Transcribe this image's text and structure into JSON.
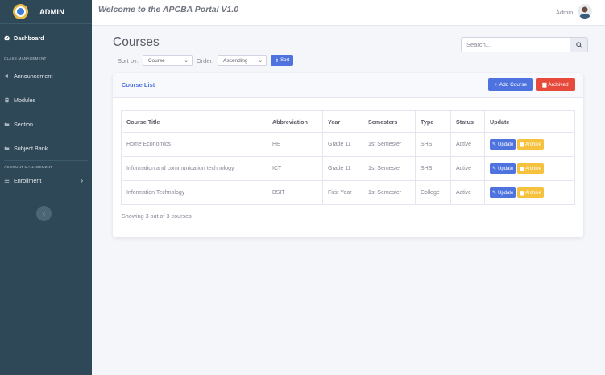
{
  "sidebar": {
    "brand": "ADMIN",
    "items": [
      {
        "label": "Dashboard"
      },
      {
        "heading": "CLASS MANAGEMENT"
      },
      {
        "label": "Announcement"
      },
      {
        "label": "Modules"
      },
      {
        "label": "Section"
      },
      {
        "label": "Subject Bank"
      },
      {
        "heading": "ACCOUNT MANAGEMENT"
      },
      {
        "label": "Enrollment"
      }
    ],
    "toggle": "‹"
  },
  "topbar": {
    "welcome": "Welcome to the APCBA Portal V1.0",
    "user": "Admin"
  },
  "main": {
    "title": "Courses",
    "sort_label": "Sort by:",
    "sort_value": "Course",
    "order_label": "Order:",
    "order_value": "Ascending",
    "sort_button": "Sort",
    "search_placeholder": "Search..."
  },
  "card": {
    "title": "Course List",
    "add_button": "Add Course",
    "archived_button": "Archived",
    "columns": [
      "Course Title",
      "Abbreviation",
      "Year",
      "Semesters",
      "Type",
      "Status",
      "Update"
    ],
    "rows": [
      {
        "title": "Home Economics",
        "abbr": "HE",
        "year": "Grade 11",
        "sem": "1st Semester",
        "type": "SHS",
        "status": "Active"
      },
      {
        "title": "Information and communication technology",
        "abbr": "ICT",
        "year": "Grade 11",
        "sem": "1st Semester",
        "type": "SHS",
        "status": "Active"
      },
      {
        "title": "Information Technology",
        "abbr": "BSIT",
        "year": "First Year",
        "sem": "1st Semester",
        "type": "College",
        "status": "Active"
      }
    ],
    "update_label": "Update",
    "archive_label": "Archive",
    "footer": "Showing 3 out of 3 courses"
  }
}
